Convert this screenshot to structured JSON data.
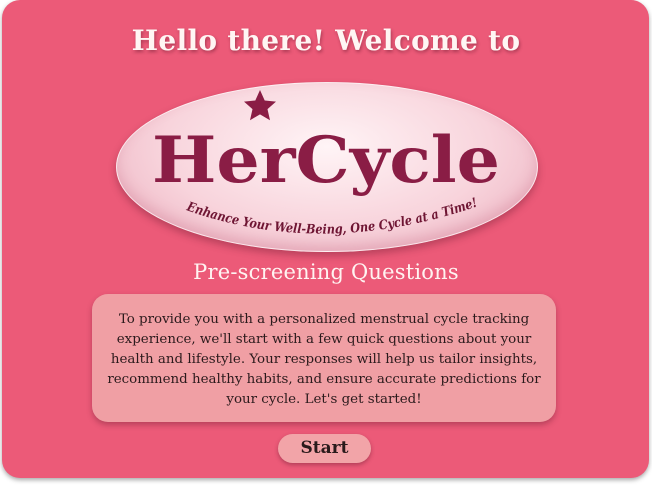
{
  "header": {
    "greeting": "Hello there! Welcome to"
  },
  "logo": {
    "brand_name": "HerCycle",
    "tagline": "Enhance Your Well-Being, One Cycle at a Time!",
    "star_icon": "star-icon"
  },
  "prescreen": {
    "title": "Pre-screening Questions",
    "description": "To provide you with a personalized menstrual cycle tracking experience, we'll start with a few quick questions about your health and lifestyle. Your responses will help us tailor insights, recommend healthy habits, and ensure accurate predictions for your cycle. Let's get started!",
    "start_label": "Start"
  },
  "colors": {
    "background": "#ec5a78",
    "brand": "#8a1d45",
    "card": "#f09fa4",
    "button": "#f2a4a8"
  }
}
